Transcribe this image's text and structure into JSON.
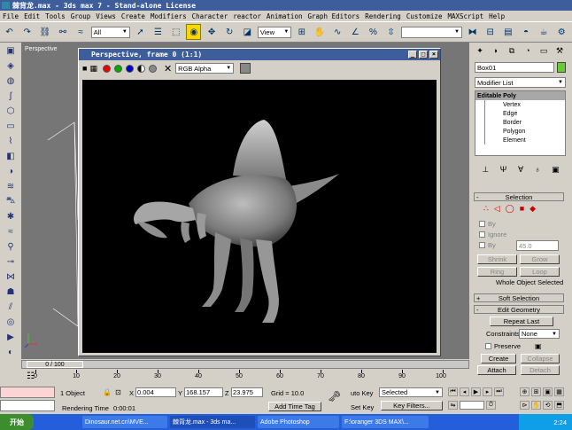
{
  "window": {
    "title": "棘背龙.max - 3ds max 7 - Stand-alone License"
  },
  "menu": [
    "File",
    "Edit",
    "Tools",
    "Group",
    "Views",
    "Create",
    "Modifiers",
    "Character",
    "reactor",
    "Animation",
    "Graph Editors",
    "Rendering",
    "Customize",
    "MAXScript",
    "Help"
  ],
  "toolbar": {
    "selection_filter": "All",
    "coord_system": "View"
  },
  "viewport": {
    "label": "Perspective"
  },
  "render_window": {
    "title": "Perspective, frame 0 (1:1)",
    "channel": "RGB Alpha"
  },
  "command_panel": {
    "object_name": "Box01",
    "modifier_list": "Modifier List",
    "stack_header": "Editable Poly",
    "stack_items": [
      "Vertex",
      "Edge",
      "Border",
      "Polygon",
      "Element"
    ],
    "selection_rollout": "Selection",
    "by_vertex": "By",
    "ignore_backfacing": "Ignore",
    "by_angle": "By",
    "angle_value": "45.0",
    "shrink": "Shrink",
    "grow": "Grow",
    "ring": "Ring",
    "loop": "Loop",
    "selection_status": "Whole Object Selected",
    "soft_selection": "Soft Selection",
    "edit_geometry": "Edit Geometry",
    "repeat_last": "Repeat Last",
    "constraints_label": "Constraints:",
    "constraints_value": "None",
    "preserve": "Preserve",
    "create": "Create",
    "collapse": "Collapse",
    "attach": "Attach",
    "detach": "Detach"
  },
  "timeline": {
    "slider": "0 / 100",
    "ticks": [
      "0",
      "10",
      "20",
      "30",
      "40",
      "50",
      "60",
      "70",
      "80",
      "90",
      "100"
    ]
  },
  "status": {
    "selection": "1 Object",
    "x_label": "X",
    "x": "0.004",
    "y_label": "Y",
    "y": "168.157",
    "z_label": "Z",
    "z": "23.975",
    "grid": "Grid = 10.0",
    "auto_key": "uto Key",
    "key_mode": "Selected",
    "set_key": "Set Key",
    "key_filters": "Key Filters...",
    "rendering_time_label": "Rendering Time",
    "rendering_time": "0:00:01",
    "add_time_tag": "Add Time Tag"
  },
  "taskbar": {
    "start": "开始",
    "tasks": [
      "Dinosaur.net.cn\\MVE...",
      "棘背龙.max - 3ds ma...",
      "Adobe Photoshop",
      "F:\\oranger 3DS MAX\\..."
    ],
    "clock": "2:24"
  }
}
